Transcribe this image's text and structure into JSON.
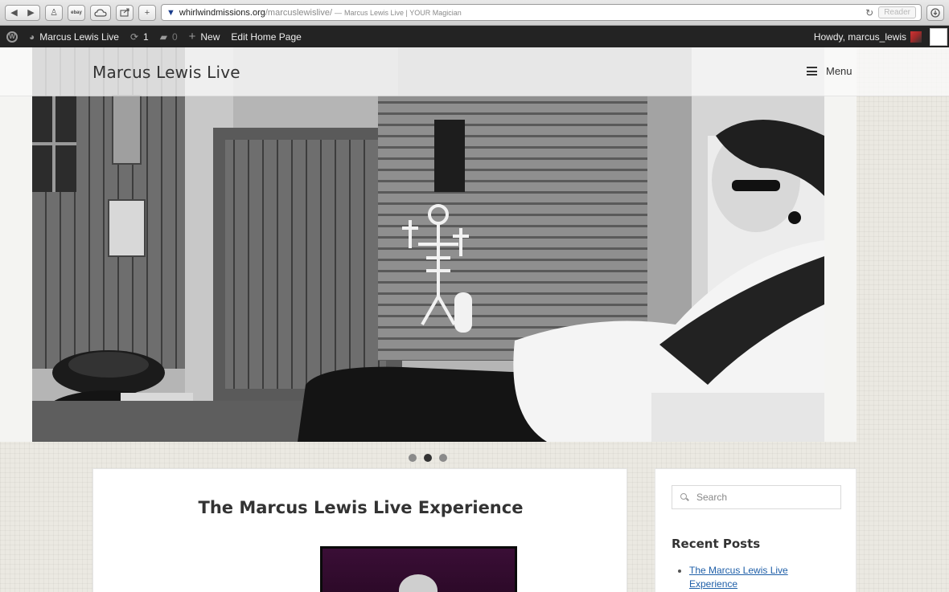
{
  "browser": {
    "url_host": "whirlwindmissions.org",
    "url_path": "/marcuslewislive/",
    "page_title_sep": "—",
    "page_title": "Marcus Lewis Live | YOUR Magician",
    "reader_label": "Reader",
    "ebay_label": "ebay"
  },
  "admin_bar": {
    "site_name": "Marcus Lewis Live",
    "updates_count": "1",
    "comments_count": "0",
    "new_label": "New",
    "edit_label": "Edit Home Page",
    "howdy": "Howdy, marcus_lewis"
  },
  "site": {
    "title": "Marcus Lewis Live",
    "menu_label": "Menu"
  },
  "slider": {
    "slide_count": 3,
    "active_slide": 2
  },
  "post": {
    "title": "The Marcus Lewis Live Experience"
  },
  "sidebar": {
    "search_placeholder": "Search",
    "recent_posts_title": "Recent Posts",
    "recent_posts": [
      {
        "title": "The Marcus Lewis Live Experience"
      }
    ]
  }
}
